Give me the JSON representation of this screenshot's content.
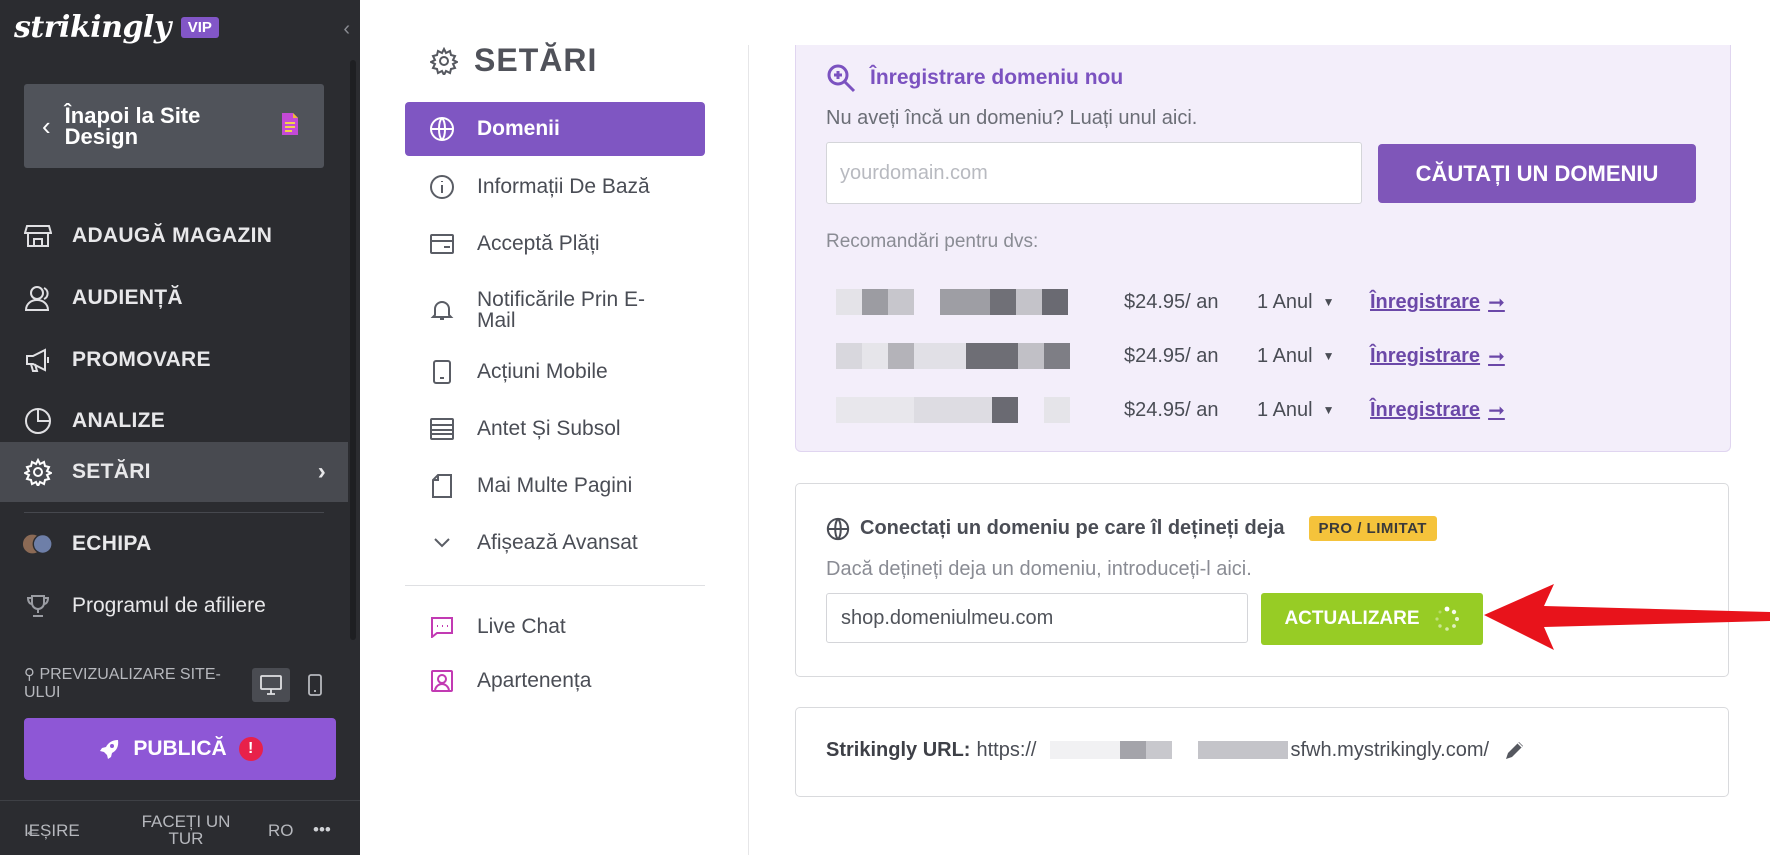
{
  "sidebar": {
    "logo_text": "strikingly",
    "vip_label": "VIP",
    "back_label": "Înapoi la Site Design",
    "items": [
      {
        "label": "ADAUGĂ MAGAZIN",
        "icon": "store-icon"
      },
      {
        "label": "AUDIENȚĂ",
        "icon": "audience-icon"
      },
      {
        "label": "PROMOVARE",
        "icon": "megaphone-icon"
      },
      {
        "label": "ANALIZE",
        "icon": "pie-chart-icon"
      },
      {
        "label": "SETĂRI",
        "icon": "gear-icon",
        "active": true
      },
      {
        "label": "ECHIPA",
        "icon": "team-avatars-icon"
      },
      {
        "label": "Programul de afiliere",
        "icon": "trophy-icon"
      }
    ],
    "preview_label": "PREVIZUALIZARE SITE-ULUI",
    "publish_label": "PUBLICĂ",
    "publish_alert": "!",
    "footer": {
      "exit_label": "IEȘIRE",
      "tour_label": "FACEȚI UN TUR",
      "lang_label": "RO",
      "more_label": "•••"
    }
  },
  "settings_menu": {
    "title": "SETĂRI",
    "items": [
      {
        "label": "Domenii",
        "icon": "globe-icon",
        "active": true
      },
      {
        "label": "Informații De Bază",
        "icon": "info-icon"
      },
      {
        "label": "Acceptă Plăți",
        "icon": "wallet-icon"
      },
      {
        "label": "Notificările Prin E-Mail",
        "icon": "bell-icon"
      },
      {
        "label": "Acțiuni Mobile",
        "icon": "mobile-icon"
      },
      {
        "label": "Antet Și Subsol",
        "icon": "layout-icon"
      },
      {
        "label": "Mai Multe Pagini",
        "icon": "pages-icon"
      },
      {
        "label": "Afișează Avansat",
        "icon": "chevron-down-icon"
      }
    ],
    "extra_items": [
      {
        "label": "Live Chat",
        "icon": "chat-icon",
        "color": "#c23ab3"
      },
      {
        "label": "Apartenența",
        "icon": "membership-icon",
        "color": "#c23ab3"
      }
    ]
  },
  "register_domain": {
    "title": "Înregistrare domeniu nou",
    "subtitle": "Nu aveți încă un domeniu? Luați unul aici.",
    "input_placeholder": "yourdomain.com",
    "search_button": "CĂUTAȚI UN DOMENIU",
    "recommendations_label": "Recomandări pentru dvs:",
    "recommendations": [
      {
        "price": "$24.95/ an",
        "term": "1 Anul",
        "action": "Înregistrare"
      },
      {
        "price": "$24.95/ an",
        "term": "1 Anul",
        "action": "Înregistrare"
      },
      {
        "price": "$24.95/ an",
        "term": "1 Anul",
        "action": "Înregistrare"
      }
    ]
  },
  "connect_domain": {
    "title": "Conectați un domeniu pe care îl dețineți deja",
    "badge": "PRO / LIMITAT",
    "subtitle": "Dacă dețineți deja un domeniu, introduceți-l aici.",
    "input_value": "shop.domeniulmeu.com",
    "update_button": "ACTUALIZARE"
  },
  "strikingly_url": {
    "label": "Strikingly URL:",
    "prefix": "https://",
    "suffix": "sfwh.mystrikingly.com/"
  },
  "colors": {
    "accent_purple": "#7f56c2",
    "update_green": "#97cc25",
    "badge_yellow": "#f5c33b",
    "annotation_red": "#e8131b"
  }
}
